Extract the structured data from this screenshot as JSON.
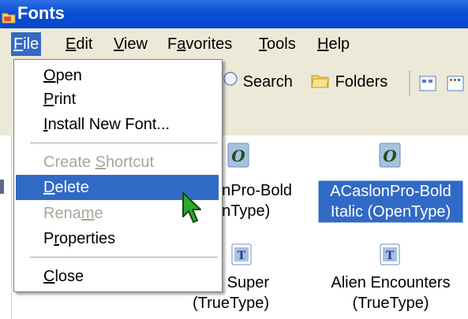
{
  "window": {
    "title": "Fonts"
  },
  "menubar": {
    "items": [
      {
        "label": "File",
        "u": "F",
        "rest": "ile"
      },
      {
        "label": "Edit",
        "u": "E",
        "rest": "dit"
      },
      {
        "label": "View",
        "u": "V",
        "rest": "iew"
      },
      {
        "label": "Favorites",
        "pre": "F",
        "u": "a",
        "rest": "vorites"
      },
      {
        "label": "Tools",
        "u": "T",
        "rest": "ools"
      },
      {
        "label": "Help",
        "u": "H",
        "rest": "elp"
      }
    ]
  },
  "toolbar": {
    "search_label": "Search",
    "folders_label": "Folders"
  },
  "file_menu": {
    "items": [
      {
        "label": "Open",
        "u": "O",
        "rest": "pen",
        "state": "normal"
      },
      {
        "label": "Print",
        "u": "P",
        "rest": "rint",
        "state": "normal"
      },
      {
        "label": "Install New Font...",
        "u": "I",
        "rest": "nstall New Font...",
        "state": "normal"
      },
      {
        "label": "Create Shortcut",
        "pre": "Create ",
        "u": "S",
        "rest": "hortcut",
        "state": "disabled"
      },
      {
        "label": "Delete",
        "u": "D",
        "rest": "elete",
        "state": "highlighted"
      },
      {
        "label": "Rename",
        "pre": "Rena",
        "u": "m",
        "rest": "e",
        "state": "disabled"
      },
      {
        "label": "Properties",
        "pre": "P",
        "u": "r",
        "rest": "operties",
        "state": "normal"
      },
      {
        "label": "Close",
        "u": "C",
        "rest": "lose",
        "state": "normal"
      }
    ]
  },
  "fonts": [
    {
      "line1": "onPro-Bold",
      "line2": "enType)",
      "icon": "opentype-font-icon",
      "selected": false
    },
    {
      "line1": "ACaslonPro-Bold",
      "line2": "Italic (OpenType)",
      "icon": "opentype-font-icon",
      "selected": true
    },
    {
      "line1": "a Super",
      "line2": "(TrueType)",
      "icon": "truetype-font-icon",
      "selected": false
    },
    {
      "line1": "Alien Encounters",
      "line2": "(TrueType)",
      "icon": "truetype-font-icon",
      "selected": false
    }
  ],
  "colors": {
    "titlebar": "#0a4fd6",
    "highlight": "#316ac5",
    "menubar": "#ece9d8",
    "disabled_text": "#a7a69b"
  }
}
